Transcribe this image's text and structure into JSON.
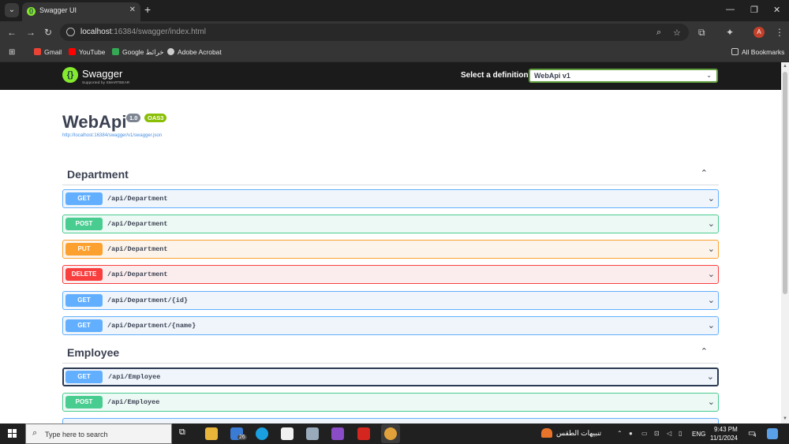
{
  "browser": {
    "tab": {
      "title": "Swagger UI"
    },
    "url": {
      "host": "localhost",
      "rest": ":16384/swagger/index.html"
    },
    "bookmarks": [
      {
        "label": "Gmail",
        "color": "#ea4335"
      },
      {
        "label": "YouTube",
        "color": "#ff0000"
      },
      {
        "label": "Google خرائط",
        "color": "#34a853"
      },
      {
        "label": "Adobe Acrobat",
        "color": "#cccccc"
      }
    ],
    "all_bookmarks": "All Bookmarks",
    "profile_initial": "A"
  },
  "swagger": {
    "brand": "Swagger",
    "brand_by": "Supported by SMARTBEAR",
    "definition_label": "Select a definition",
    "definition_value": "WebApi v1",
    "title": "WebApi",
    "version": "1.0",
    "oas": "OAS3",
    "spec_url": "http://localhost:16384/swagger/v1/swagger.json",
    "sections": [
      {
        "name": "Department",
        "ops": [
          {
            "method": "GET",
            "path": "/api/Department"
          },
          {
            "method": "POST",
            "path": "/api/Department"
          },
          {
            "method": "PUT",
            "path": "/api/Department"
          },
          {
            "method": "DELETE",
            "path": "/api/Department"
          },
          {
            "method": "GET",
            "path": "/api/Department/{id}"
          },
          {
            "method": "GET",
            "path": "/api/Department/{name}"
          }
        ]
      },
      {
        "name": "Employee",
        "ops": [
          {
            "method": "GET",
            "path": "/api/Employee"
          },
          {
            "method": "POST",
            "path": "/api/Employee"
          }
        ]
      }
    ]
  },
  "taskbar": {
    "search_placeholder": "Type here to search",
    "mail_badge": "26",
    "weather": "تنبيهات الطقس",
    "lang": "ENG",
    "time": "9:43 PM",
    "date": "11/1/2024",
    "notifications": "4"
  }
}
